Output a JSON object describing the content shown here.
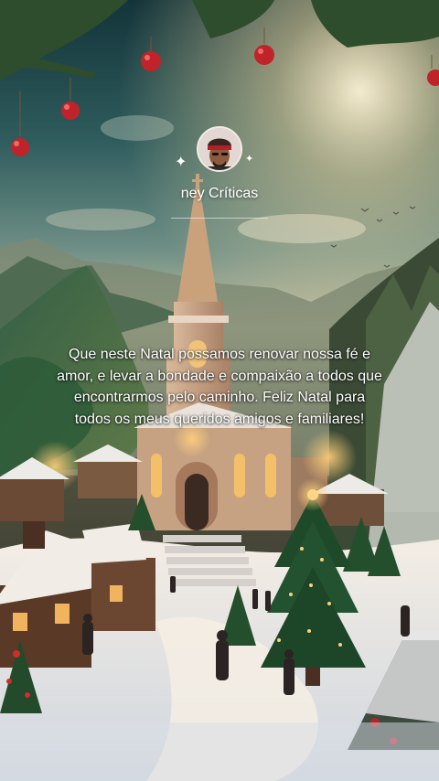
{
  "profile": {
    "username": "ney Críticas"
  },
  "post": {
    "message": "Que neste Natal possamos renovar nossa fé e amor, e levar a bondade e compaixão a todos que encontrarmos pelo caminho. Feliz Natal para todos os meus queridos amigos e familiares!"
  },
  "icons": {
    "sparkle": "sparkle-icon",
    "avatar": "avatar-icon"
  },
  "colors": {
    "text": "#ffffff",
    "sky": "#2f5a5a",
    "glow": "#f3d8a0",
    "snow": "#eef0f2",
    "tree": "#1e4a2a"
  }
}
